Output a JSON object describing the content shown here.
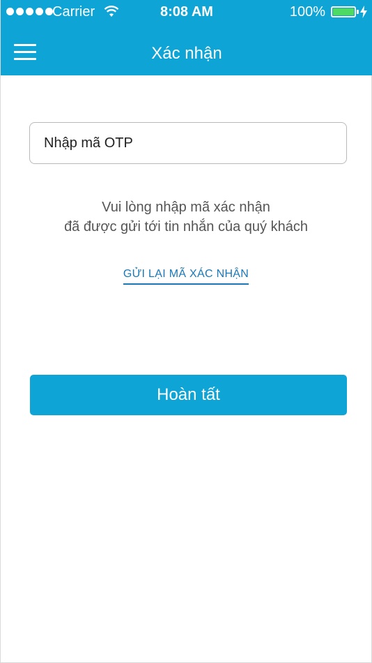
{
  "status_bar": {
    "carrier": "Carrier",
    "time": "8:08 AM",
    "battery": "100%",
    "signal_dots": 5,
    "battery_color": "#4cd964"
  },
  "navbar": {
    "title": "Xác nhận",
    "menu_icon": "hamburger-menu-icon",
    "background": "#0ea5d6"
  },
  "otp": {
    "placeholder": "Nhập mã OTP",
    "value": ""
  },
  "instruction": {
    "line1": "Vui lòng nhập mã xác nhận",
    "line2": "đã được gửi tới tin nhắn của quý khách"
  },
  "resend": {
    "label": "GỬI LẠI MÃ XÁC NHẬN"
  },
  "finish": {
    "label": "Hoàn tất"
  }
}
